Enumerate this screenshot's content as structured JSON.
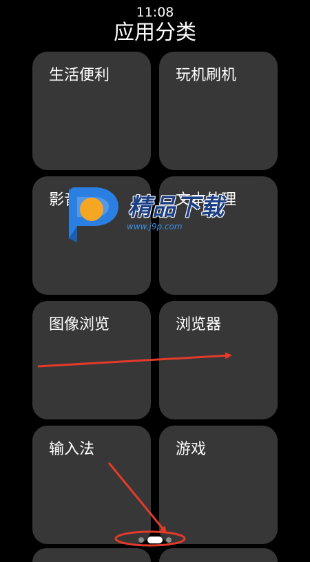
{
  "status_bar": {
    "time": "11:08"
  },
  "header": {
    "title": "应用分类"
  },
  "categories": [
    {
      "label": "生活便利"
    },
    {
      "label": "玩机刷机"
    },
    {
      "label": "影音娱乐"
    },
    {
      "label": "文本处理"
    },
    {
      "label": "图像浏览"
    },
    {
      "label": "浏览器"
    },
    {
      "label": "输入法"
    },
    {
      "label": "游戏"
    }
  ],
  "watermark": {
    "text": "精品下载",
    "url": "www.j9p.com"
  },
  "page_indicator": {
    "total_pages": 3,
    "active_index": 1
  },
  "colors": {
    "background": "#000000",
    "tile": "#373737",
    "annotation": "#e53a2a"
  }
}
